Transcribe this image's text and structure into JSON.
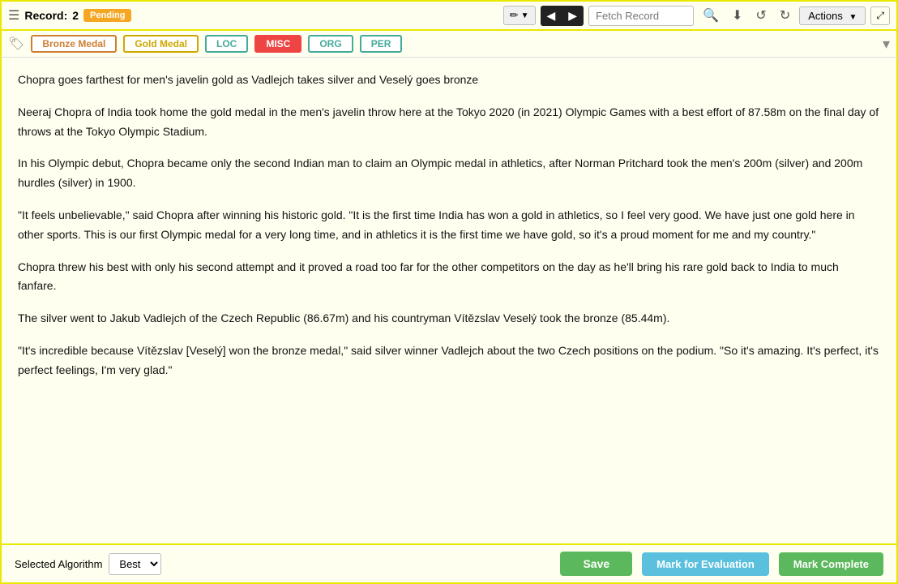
{
  "toolbar": {
    "record_label": "Record:",
    "record_number": "2",
    "status": "Pending",
    "fetch_placeholder": "Fetch Record",
    "actions_label": "Actions",
    "pencil_icon": "✏",
    "prev_icon": "◀",
    "next_icon": "▶",
    "search_icon": "🔍",
    "save_icon": "💾",
    "undo_icon": "↺",
    "redo_icon": "↻"
  },
  "tags": {
    "items": [
      {
        "label": "Bronze Medal",
        "class": "bronze"
      },
      {
        "label": "Gold Medal",
        "class": "gold"
      },
      {
        "label": "LOC",
        "class": "loc"
      },
      {
        "label": "MISC",
        "class": "misc"
      },
      {
        "label": "ORG",
        "class": "org"
      },
      {
        "label": "PER",
        "class": "per"
      }
    ]
  },
  "content": {
    "title": "Chopra goes farthest for men's javelin gold as Vadlejch takes silver and Veselý goes bronze",
    "paragraphs": [
      "Neeraj Chopra of India took home the gold medal in the men's javelin throw here at the Tokyo 2020 (in 2021) Olympic Games with a best effort of 87.58m on the final day of throws at the Tokyo Olympic Stadium.",
      "In his Olympic debut, Chopra became only the second Indian man to claim an Olympic medal in athletics, after Norman Pritchard took the men's 200m (silver) and 200m hurdles (silver) in 1900.",
      "\"It feels unbelievable,\" said Chopra after winning his historic gold. \"It is the first time India has won a gold in athletics, so I feel very good. We have just one gold here in other sports. This is our first Olympic medal for a very long time, and in athletics it is the first time we have gold, so it's a proud moment for me and my country.\"",
      "Chopra threw his best with only his second attempt and it proved a road too far for the other competitors on the day as he'll bring his rare gold back to India to much fanfare.",
      "The silver went to Jakub Vadlejch of the Czech Republic (86.67m) and his countryman Vítězslav Veselý took the bronze (85.44m).",
      "\"It's incredible because Vítězslav [Veselý] won the bronze medal,\" said silver winner Vadlejch about the two Czech positions on the podium. \"So it's amazing. It's perfect, it's perfect feelings, I'm very glad.\""
    ]
  },
  "footer": {
    "algo_label": "Selected Algorithm",
    "algo_value": "Best",
    "save_label": "Save",
    "mark_eval_label": "Mark for Evaluation",
    "mark_complete_label": "Mark Complete"
  }
}
